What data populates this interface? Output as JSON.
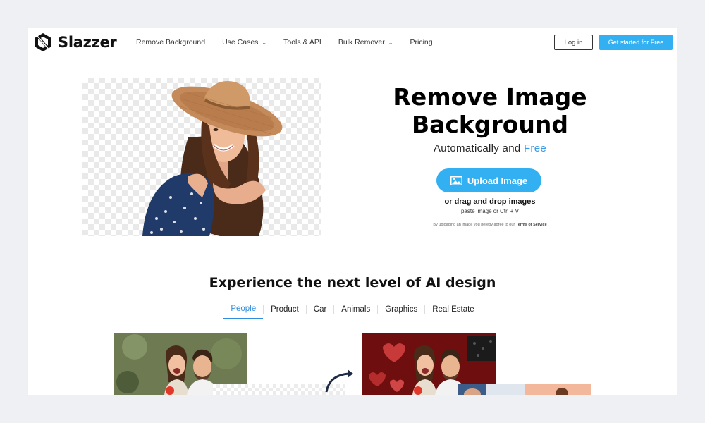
{
  "brand": {
    "name": "Slazzer",
    "logo_icon": "slazzer-logo-icon"
  },
  "nav": {
    "items": [
      {
        "label": "Remove Background",
        "dropdown": false
      },
      {
        "label": "Use Cases",
        "dropdown": true
      },
      {
        "label": "Tools & API",
        "dropdown": false
      },
      {
        "label": "Bulk Remover",
        "dropdown": true
      },
      {
        "label": "Pricing",
        "dropdown": false
      }
    ],
    "login_label": "Log in",
    "cta_label": "Get started for Free"
  },
  "hero": {
    "title_line1": "Remove Image",
    "title_line2": "Background",
    "subtitle_prefix": "Automatically and",
    "subtitle_highlight": "Free",
    "upload_label": "Upload Image",
    "upload_icon": "image-icon",
    "drag_text": "or drag and drop images",
    "paste_text": "paste image or Ctrl + V",
    "terms_prefix": "By uploading an image you hereby agree to our",
    "terms_link": "Terms of Service"
  },
  "section": {
    "title": "Experience the next level of AI design",
    "tabs": [
      "People",
      "Product",
      "Car",
      "Animals",
      "Graphics",
      "Real Estate"
    ],
    "active_tab": "People"
  },
  "colors": {
    "accent": "#33b0f2",
    "link": "#2f8ee0",
    "text": "#111111",
    "page_bg": "#eef0f3"
  }
}
